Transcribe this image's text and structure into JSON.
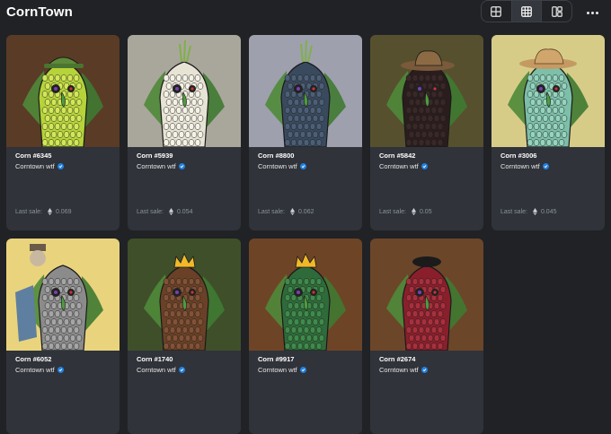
{
  "header": {
    "title": "CornTown",
    "view_options": [
      {
        "icon": "large-grid-icon",
        "active": false
      },
      {
        "icon": "small-grid-icon",
        "active": true
      },
      {
        "icon": "mixed-grid-icon",
        "active": false
      }
    ],
    "more_icon": "more-horizontal-icon"
  },
  "labels": {
    "last_sale": "Last sale:"
  },
  "colors": {
    "background": "#202225",
    "card": "#303339",
    "verified": "#2081e2",
    "muted_text": "#8a939b"
  },
  "items": [
    {
      "name": "Corn #6345",
      "collection": "Corntown wtf",
      "last_sale": "0.069",
      "bg": "#5a3b26",
      "corn": "#b6d33a",
      "kernel": "#d2e65a",
      "hat": "cap-green"
    },
    {
      "name": "Corn #5939",
      "collection": "Corntown wtf",
      "last_sale": "0.054",
      "bg": "#a9a79c",
      "corn": "#e8e4d5",
      "kernel": "#f4f1e6",
      "hat": "sprout"
    },
    {
      "name": "Corn #8800",
      "collection": "Corntown wtf",
      "last_sale": "0.062",
      "bg": "#9ea0ad",
      "corn": "#3a4a5e",
      "kernel": "#4c5f77",
      "hat": "sprout"
    },
    {
      "name": "Corn #5842",
      "collection": "Corntown wtf",
      "last_sale": "0.05",
      "bg": "#57502e",
      "corn": "#2b1d1d",
      "kernel": "#3a2828",
      "hat": "cowboy"
    },
    {
      "name": "Corn #3006",
      "collection": "Corntown wtf",
      "last_sale": "0.045",
      "bg": "#d6cc88",
      "corn": "#7dbfa9",
      "kernel": "#95d3be",
      "hat": "straw"
    },
    {
      "name": "Corn #6052",
      "collection": "Corntown wtf",
      "last_sale": "",
      "bg": "#e9d47d",
      "corn": "#8b8b8b",
      "kernel": "#a5a5a5",
      "hat": "scarecrow"
    },
    {
      "name": "Corn #1740",
      "collection": "Corntown wtf",
      "last_sale": "",
      "bg": "#3f4f2a",
      "corn": "#6a4127",
      "kernel": "#825236",
      "hat": "crown"
    },
    {
      "name": "Corn #9917",
      "collection": "Corntown wtf",
      "last_sale": "",
      "bg": "#6e4427",
      "corn": "#2f6b3a",
      "kernel": "#3f8a4c",
      "hat": "crown"
    },
    {
      "name": "Corn #2674",
      "collection": "Corntown wtf",
      "last_sale": "",
      "bg": "#6c4629",
      "corn": "#8a1f2c",
      "kernel": "#a8303c",
      "hat": "beret"
    }
  ]
}
